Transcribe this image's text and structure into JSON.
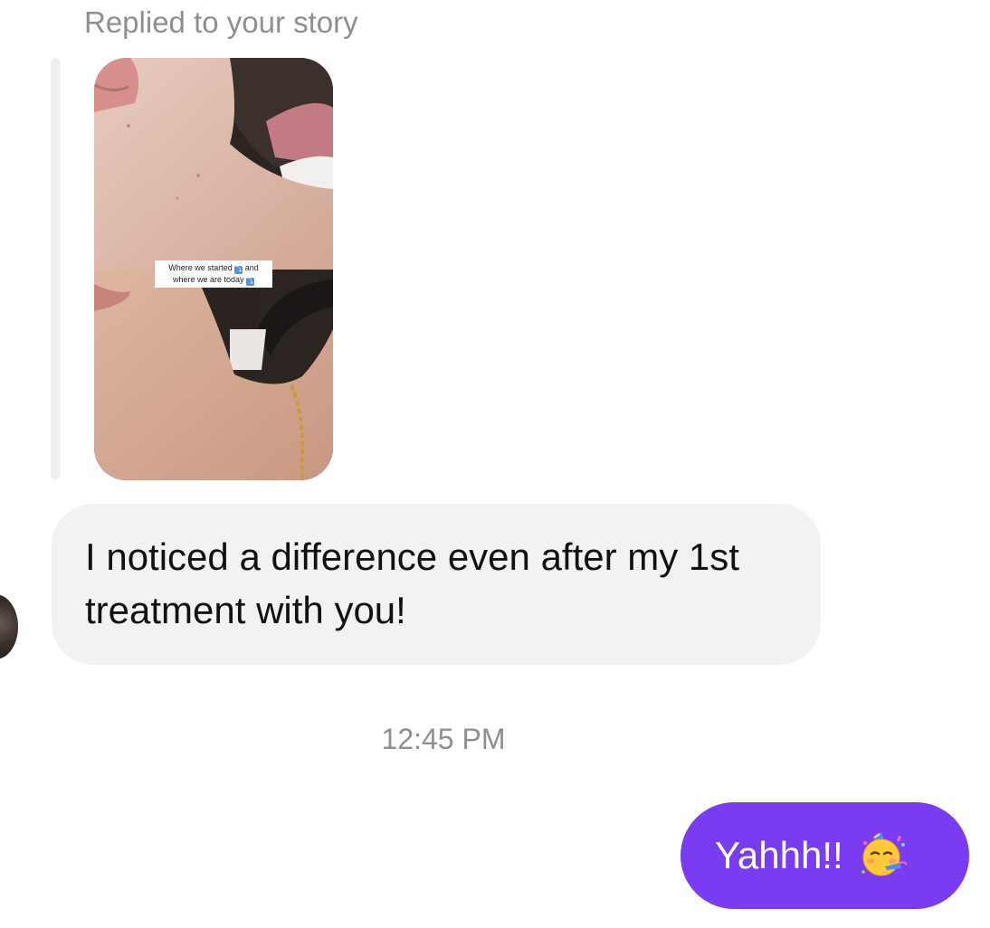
{
  "reply_header": {
    "label": "Replied to your story"
  },
  "story": {
    "caption_line1": "Where we started",
    "caption_and": "and",
    "caption_line2": "where we are today",
    "caption_arrow": "⤵"
  },
  "messages": [
    {
      "direction": "incoming",
      "text": "I noticed a difference even after my 1st treatment with you!"
    },
    {
      "direction": "outgoing",
      "text": "Yahhh!!",
      "emoji": "partying-face-icon"
    }
  ],
  "timestamp": "12:45 PM",
  "colors": {
    "outgoing_bubble": "#7a3cf0",
    "incoming_bubble": "#f1f2f4",
    "meta_text": "#8e8e93"
  }
}
